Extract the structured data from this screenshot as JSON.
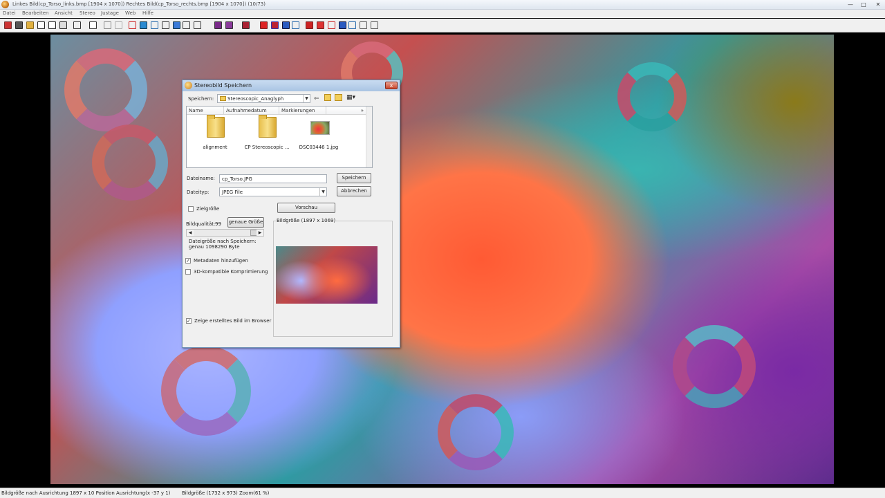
{
  "window": {
    "title": "Linkes Bild(cp_Torso_links.bmp [1904 x 1070]) Rechtes Bild(cp_Torso_rechts.bmp [1904 x 1070]) (10/73)",
    "min": "—",
    "max": "□",
    "close": "✕"
  },
  "menu": [
    "Datei",
    "Bearbeiten",
    "Ansicht",
    "Stereo",
    "Justage",
    "Web",
    "Hilfe"
  ],
  "dialog": {
    "title": "Stereobild Speichern",
    "close_label": "x",
    "save_in_label": "Speichern:",
    "save_in_value": "Stereoscopic_Anaglyph",
    "columns": [
      "Name",
      "Aufnahmedatum",
      "Markierungen",
      "»"
    ],
    "files": [
      {
        "name": "alignment",
        "kind": "folder"
      },
      {
        "name": "CP Stereoscopic ...",
        "kind": "folder"
      },
      {
        "name": "DSC03446 1.jpg",
        "kind": "image"
      }
    ],
    "filename_label": "Dateiname:",
    "filename_value": "cp_Torso.JPG",
    "filetype_label": "Dateityp:",
    "filetype_value": "JPEG File",
    "save_button": "Speichern",
    "cancel_button": "Abbrechen",
    "preview_button": "Vorschau",
    "target_size_label": "Zielgröße",
    "quality_label": "Bildqualität:",
    "quality_value": "99",
    "exact_size_button": "genaue Größe",
    "size_info_1": "Dateigröße nach Speichern:",
    "size_info_2": "genau 1098290 Byte",
    "checkbox_1": "Metadaten hinzufügen",
    "checkbox_2": "3D-kompatible Komprimierung",
    "checkbox_3": "Zeige erstelltes Bild im Browser",
    "group_title": "Bildgröße (1897 x 1069)"
  },
  "status": {
    "left": "Bildgröße nach Ausrichtung 1897 x 10  Position Ausrichtung(x -37 y 1)",
    "right": "Bildgröße (1732 x 973)  Zoom(61 %)"
  }
}
